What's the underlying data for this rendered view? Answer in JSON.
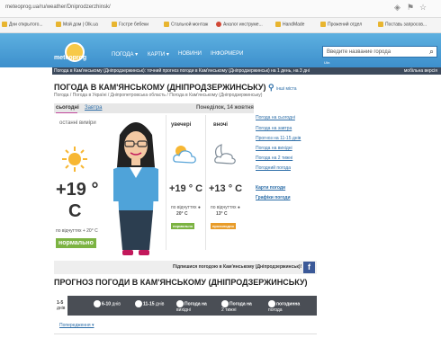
{
  "browser": {
    "url": "meteoprog.ua/ru/weather/Dniprodzerzhinsk/",
    "bookmarks": [
      "Дни открытого...",
      "Мой дом | Olk.ua",
      "Гостре бебеки",
      "Стальной монтаж",
      "Аналог инструме...",
      "HandMade",
      "Прожений отдел",
      "Поставь запросов..."
    ]
  },
  "header": {
    "logo_text": "meteoprog",
    "nav": [
      "ПОГОДА ▾",
      "КАРТИ ▾",
      "НОВИНИ",
      "ІНФОРМЕРИ"
    ],
    "search_placeholder": "Введите название города",
    "search_sub": "Ukr.",
    "strip_text": "Погода в Кам'янському (Дніпродзержинськ): точний прогноз погоди в Кам'янському (Дніпродзержинськ) на 1 день, на 3 дні",
    "strip_right": "мобільна версія"
  },
  "page": {
    "title": "ПОГОДА В КАМ'ЯНСЬКОМУ (ДНІПРОДЗЕРЖИНСЬКУ)",
    "title_link": "інші міста",
    "breadcrumb": "Погода / Погода в Україні / Дніпропетровська область / Погода в Кам'янському (Дніпродзержинську)"
  },
  "tabs": {
    "today": "сьогодні",
    "tomorrow": "Завтра",
    "date": "Понеділок, 14 жовтня"
  },
  "current": {
    "label": "останні виміри",
    "temp": "+19 °",
    "unit": "C",
    "feels": "по відчуттях + 20° С",
    "status": "нормально"
  },
  "evening": {
    "label": "увечері",
    "temp": "+19 ° C",
    "feels_label": "по відчуттях ●",
    "feels_val": "20° C",
    "status": "нормально"
  },
  "night": {
    "label": "вночі",
    "temp": "+13 ° C",
    "feels_label": "по відчуттях ●",
    "feels_val": "13° C",
    "status": "прохолодно"
  },
  "right_links": [
    "Погода на сьогодні",
    "Погода на завтра",
    "Прогноз на 11-15 днів",
    "Погода на вихідні",
    "Погода на 2 тижні",
    "Погодний погода"
  ],
  "right_bold": [
    "Карти погоди",
    "Графіки погоди"
  ],
  "subscribe": "Підпишися погодою в Кам'янському (Дніпродзержинськ)!",
  "forecast": {
    "title": "ПРОГНОЗ ПОГОДИ В КАМ'ЯНСЬКОМУ (ДНІПРОДЗЕРЖИНСЬКУ)",
    "tabs": [
      {
        "big": "1-5",
        "small": "днів"
      },
      {
        "big": "6-10",
        "small": "днів"
      },
      {
        "big": "11-15",
        "small": "днів"
      },
      {
        "big": "Погода на",
        "small": "вихідні"
      },
      {
        "big": "Погода на",
        "small": "2 тижні"
      },
      {
        "big": "погодинна",
        "small": "погода"
      }
    ],
    "link": "Попередження ▾"
  },
  "colors": {
    "header": "#3d8fcc",
    "accent_green": "#7cb342",
    "accent_orange": "#e89c2a",
    "link": "#2d6ea8"
  }
}
